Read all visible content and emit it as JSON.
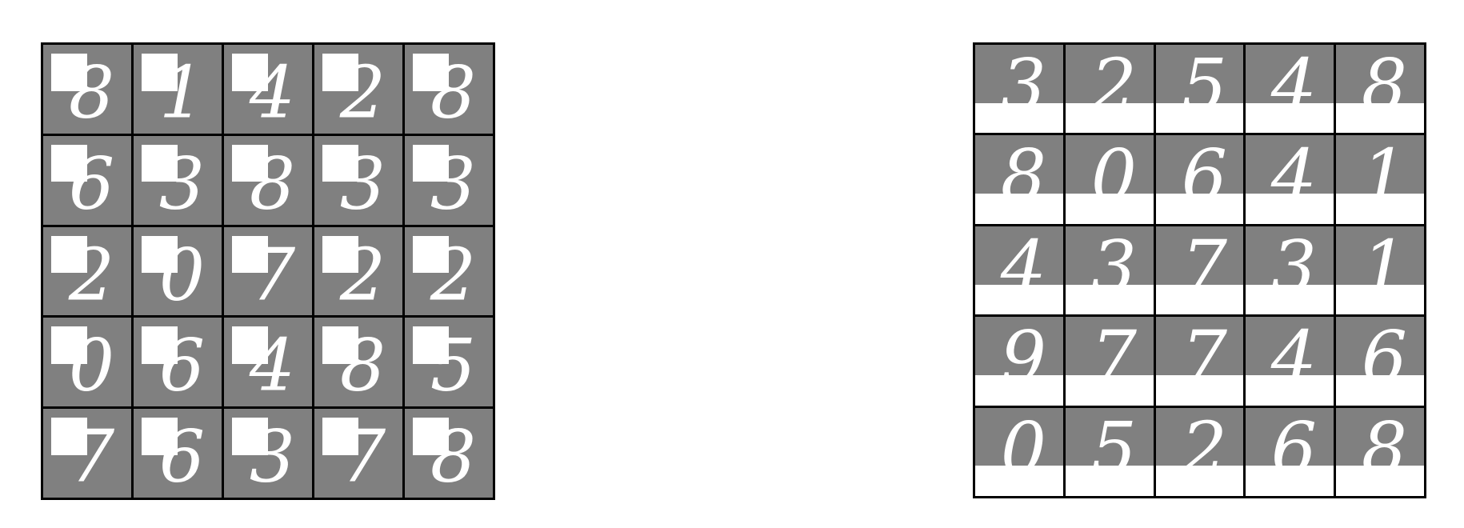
{
  "panels": [
    {
      "id": "left",
      "mask": "top-left",
      "digits": [
        "8",
        "1",
        "4",
        "2",
        "8",
        "6",
        "3",
        "8",
        "3",
        "3",
        "2",
        "0",
        "7",
        "2",
        "2",
        "0",
        "6",
        "4",
        "8",
        "5",
        "7",
        "6",
        "3",
        "7",
        "8"
      ]
    },
    {
      "id": "right",
      "mask": "bottom",
      "digits": [
        "3",
        "2",
        "5",
        "4",
        "8",
        "8",
        "0",
        "6",
        "4",
        "1",
        "4",
        "3",
        "7",
        "3",
        "1",
        "9",
        "7",
        "7",
        "4",
        "6",
        "0",
        "5",
        "2",
        "6",
        "8"
      ]
    }
  ],
  "colors": {
    "background": "#808080",
    "mask": "#ffffff",
    "stroke": "#ffffff",
    "border": "#000000"
  }
}
